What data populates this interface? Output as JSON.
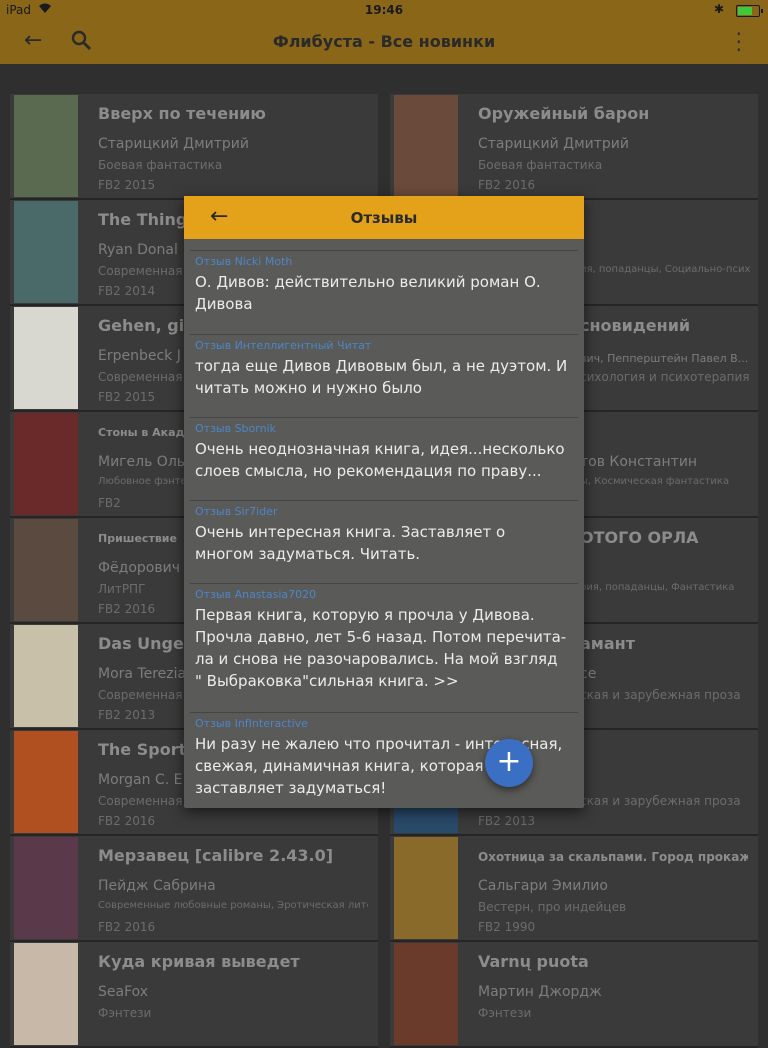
{
  "status": {
    "device": "iPad",
    "time": "19:46"
  },
  "appbar": {
    "title": "Флибуста - Все новинки"
  },
  "books": [
    {
      "title": "Вверх по течению",
      "author": "Старицкий Дмитрий",
      "genre": "Боевая фантастика",
      "format": "FB2 2015",
      "cover": "#5a6a50"
    },
    {
      "title": "Оружейный барон",
      "author": "Старицкий Дмитрий",
      "genre": "Боевая фантастика",
      "format": "FB2 2016",
      "cover": "#6a4a3a"
    },
    {
      "title": "The Thing",
      "author": "Ryan Donal",
      "genre": "Современная",
      "format": "FB2 2014",
      "cover": "#4a6a6a"
    },
    {
      "title": "",
      "author": "",
      "genre": "ия, попаданцы, Социально-псих...",
      "format": "",
      "cover": ""
    },
    {
      "title": "Gehen, gin",
      "author": "Erpenbeck J",
      "genre": "Современная",
      "format": "FB2 2015",
      "cover": "#d8d8d0"
    },
    {
      "title": "сновидений",
      "author": "вич, Пепперштейн Павел В...",
      "genre": "сихология и психотерапия",
      "format": "",
      "cover": ""
    },
    {
      "title": "Стоны в Акаде",
      "author": "Мигель Оль",
      "genre": "Любовное фэнтези",
      "format": "FB2",
      "cover": "#6a2a2a"
    },
    {
      "title": "",
      "author": "тов Константин",
      "genre": "ы, Космическая фантастика",
      "format": "",
      "cover": ""
    },
    {
      "title": "Пришествие",
      "author": "Фёдорович",
      "genre": "ЛитРПГ",
      "format": "FB2 2016",
      "cover": "#5a4a40"
    },
    {
      "title": "ОТОГО ОРЛА",
      "author": "",
      "genre": "рия, попаданцы, Фантастика",
      "format": "",
      "cover": ""
    },
    {
      "title": "Das Ungeh",
      "author": "Mora Terezia",
      "genre": "Современная",
      "format": "FB2 2013",
      "cover": "#c8c0a8"
    },
    {
      "title": "амант",
      "author": "ce",
      "genre": "ская и зарубежная проза",
      "format": "",
      "cover": ""
    },
    {
      "title": "The Sport c",
      "author": "Morgan C. E",
      "genre": "Современная",
      "format": "FB2 2016",
      "cover": "#b05020"
    },
    {
      "title": "",
      "author": "",
      "genre": "ская и зарубежная проза",
      "format": "FB2 2013",
      "cover": "#2a4a6a"
    },
    {
      "title": "Мерзавец [calibre 2.43.0]",
      "author": "Пейдж Сабрина",
      "genre": "Современные любовные романы, Эротическая литера...",
      "format": "FB2 2016",
      "cover": "#5a3a4a"
    },
    {
      "title": "Охотница за скальпами. Город прокаже...",
      "author": "Сальгари Эмилио",
      "genre": "Вестерн, про индейцев",
      "format": "FB2 1990",
      "cover": "#8a6a2a"
    },
    {
      "title": "Куда кривая выведет",
      "author": "SeaFox",
      "genre": "Фэнтези",
      "format": "",
      "cover": "#c8b8a8"
    },
    {
      "title": "Varnų puota",
      "author": "Мартин Джордж",
      "genre": "Фэнтези",
      "format": "",
      "cover": "#6a3a2a"
    }
  ],
  "dialog": {
    "title": "Отзывы",
    "reviews": [
      {
        "who": "Отзыв Nicki Moth",
        "text": "О. Дивов: действительно великий роман О. Дивова"
      },
      {
        "who": "Отзыв Интеллигентный Читат",
        "text": "тогда еще Дивов Дивовым был, а не дуэтом. И читать можно и нужно было"
      },
      {
        "who": "Отзыв Sbornik",
        "text": "Очень неоднозначная книга, идея...несколько слоев смысла, но рекомендация по праву..."
      },
      {
        "who": "Отзыв Sir7ider",
        "text": "Очень интересная книга. Заставляет о многом задуматься. Читать."
      },
      {
        "who": "Отзыв Anastasia7020",
        "text": "Первая книга, которую я прочла у Дивова. Прочла давно, лет 5-6 назад. Потом перечита-ла и снова не разочаровались. На мой взгляд \" Выбраковка\"сильная книга.    >>"
      },
      {
        "who": "Отзыв InfInteractive",
        "text": "Ни разу не жалею что прочитал - интересная, свежая, динамичная книга, которая заставляет задуматься!"
      }
    ]
  },
  "fab": {
    "label": "+"
  }
}
